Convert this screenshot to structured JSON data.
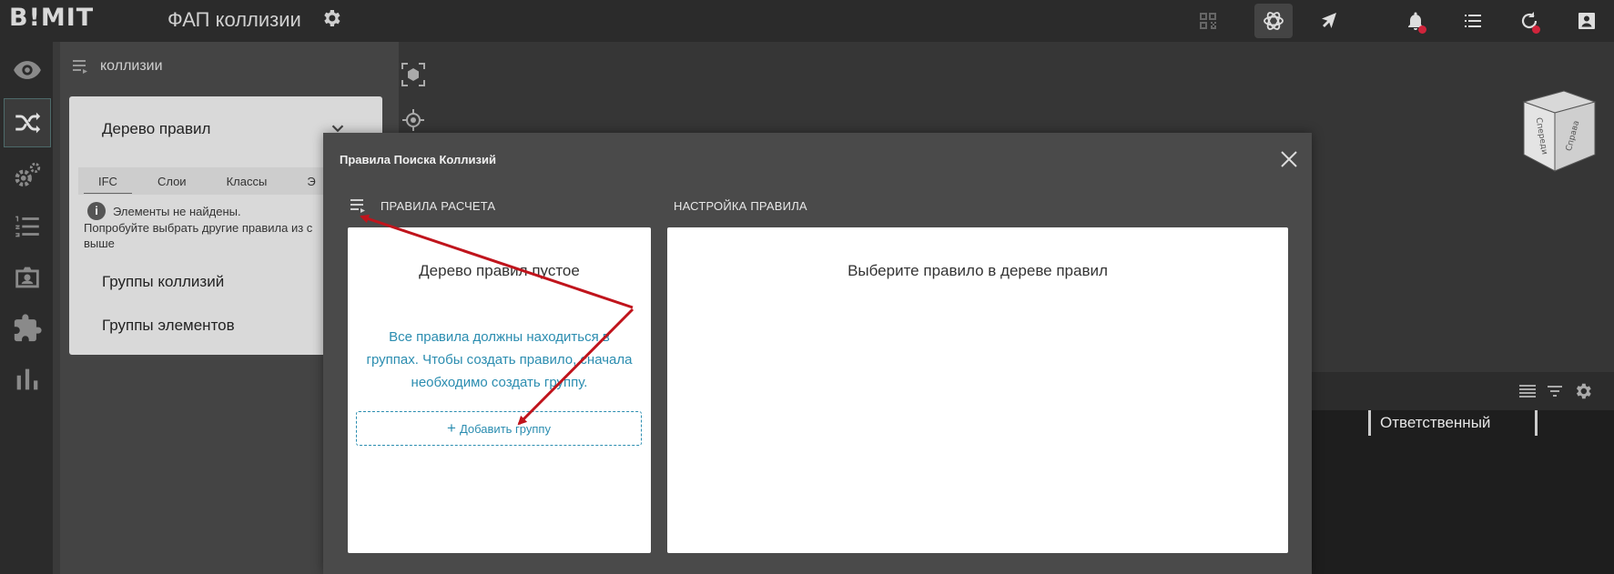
{
  "app": {
    "logo": "B!MIT",
    "project_title": "ФАП коллизии",
    "icons": [
      "gear-icon",
      "qr-code-icon",
      "model-icon",
      "cursor-icon",
      "bell-icon",
      "list-icon",
      "history-icon",
      "account-icon"
    ],
    "notification_color": "#d0243b"
  },
  "rail": {
    "items": [
      "eye-icon",
      "shuffle-icon",
      "settings-gears-icon",
      "numbered-list-icon",
      "contact-card-icon",
      "puzzle-icon",
      "bar-chart-icon"
    ],
    "active_item": "shuffle-icon"
  },
  "collisions_panel": {
    "header": "коллизии",
    "rules_tree": {
      "title": "Дерево правил",
      "tabs": [
        "IFC",
        "Слои",
        "Классы",
        "Э"
      ],
      "selected_tab": "IFC",
      "empty_line1": "Элементы не найдены.",
      "empty_line2": "Попробуйте выбрать другие правила из с",
      "empty_line3": "выше"
    },
    "groups": {
      "collision_groups": "Группы коллизий",
      "element_groups": "Группы элементов"
    }
  },
  "grid": {
    "column_header": "Ответственный"
  },
  "modal": {
    "title": "Правила Поиска Коллизий",
    "left_section_label": "ПРАВИЛА РАСЧЕТА",
    "right_section_label": "НАСТРОЙКА ПРАВИЛА",
    "empty_tree_title": "Дерево правил пустое",
    "hint": "Все правила должны находиться в группах. Чтобы создать правило, сначала необходимо создать группу.",
    "add_group_button": "Добавить группу",
    "right_empty": "Выберите правило в дереве правил"
  },
  "cube": {
    "face_left": "Спереди",
    "face_right": "Справа"
  },
  "colors": {
    "accent": "#2b8db0",
    "annotation_arrow": "#c0141c"
  }
}
